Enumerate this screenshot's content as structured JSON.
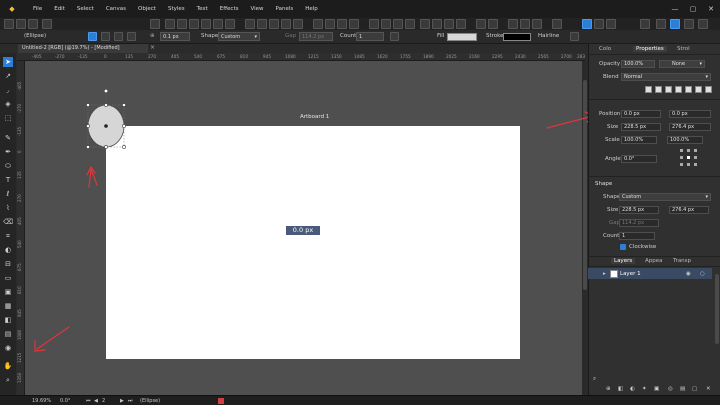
{
  "menubar": {
    "items": [
      "File",
      "Edit",
      "Select",
      "Canvas",
      "Object",
      "Styles",
      "Text",
      "Effects",
      "View",
      "Panels",
      "Help"
    ]
  },
  "context": {
    "selection": "(Ellipse)",
    "stroke_width": "0.1 px",
    "shape_label": "Shape",
    "shape_value": "Custom",
    "gap_label": "Gap",
    "gap_value": "114.2 px",
    "count_label": "Count",
    "count_value": "1",
    "fill_label": "Fill",
    "stroke_label": "Stroke",
    "hairline_label": "Hairline"
  },
  "document": {
    "tab_title": "Untitled-2 [RGB] (@19.7%) - [Modified]",
    "close": "×"
  },
  "ruler": {
    "h_ticks": [
      "-405",
      "-270",
      "-135",
      "0",
      "135",
      "270",
      "405",
      "540",
      "675",
      "810",
      "945",
      "1080",
      "1215",
      "1350",
      "1485",
      "1620",
      "1755",
      "1890",
      "2025",
      "2160",
      "2295",
      "2430",
      "2565",
      "2700",
      "2835"
    ],
    "v_ticks": [
      "-405",
      "-270",
      "-135",
      "0",
      "135",
      "270",
      "405",
      "540",
      "675",
      "810",
      "945",
      "1080",
      "1215",
      "1350",
      "1485"
    ]
  },
  "canvas": {
    "artboard_label": "Artboard 1",
    "badge": "0.0 px"
  },
  "panel": {
    "tabs": [
      "Colo",
      "Properties",
      "Strol"
    ],
    "active_tab": "Properties",
    "opacity_label": "Opacity",
    "opacity_value": "100.0%",
    "opacity_mode": "None",
    "blend_label": "Blend",
    "blend_value": "Normal",
    "position_label": "Position",
    "pos_x": "0.0 px",
    "pos_y": "0.0 px",
    "size_label": "Size",
    "size_w": "228.5 px",
    "size_h": "276.4 px",
    "scale_label": "Scale",
    "scale_x": "100.0%",
    "scale_y": "100.0%",
    "angle_label": "Angle",
    "angle_value": "0.0°",
    "shape_section": "Shape",
    "shape_label": "Shape",
    "shape_value": "Custom",
    "shape_size_label": "Size",
    "shape_size_w": "228.5 px",
    "shape_size_h": "276.4 px",
    "gap_label": "Gap",
    "gap_value": "114.2 px",
    "count_label": "Count",
    "count_value": "1",
    "clockwise_label": "Clockwise",
    "layers_tabs": [
      "Layers",
      "Appea",
      "Transp"
    ],
    "layer_name": "Layer 1"
  },
  "status": {
    "zoom": "19.69%",
    "angle": "0.0°",
    "page": "2",
    "selection": "(Ellipse)"
  },
  "colors": {
    "accent": "#2c7fd6",
    "arrow": "#e0353b"
  }
}
